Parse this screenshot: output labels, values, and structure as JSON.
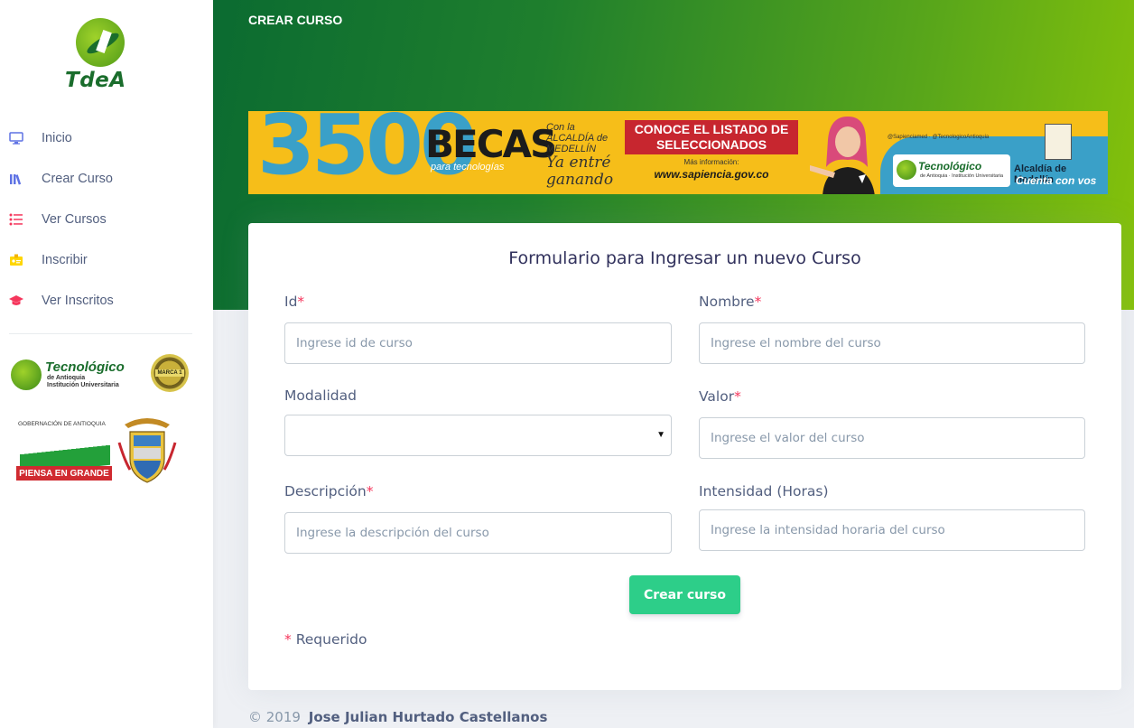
{
  "brand": {
    "logo_text": "TdeA"
  },
  "sidebar": {
    "items": [
      {
        "label": "Inicio",
        "icon": "monitor-icon",
        "color": "#5e72e4"
      },
      {
        "label": "Crear Curso",
        "icon": "books-icon",
        "color": "#5e72e4"
      },
      {
        "label": "Ver Cursos",
        "icon": "list-icon",
        "color": "#f5365c"
      },
      {
        "label": "Inscribir",
        "icon": "badge-icon",
        "color": "#ffd600"
      },
      {
        "label": "Ver Inscritos",
        "icon": "graduation-cap-icon",
        "color": "#f5365c"
      }
    ],
    "sponsor_tdea": {
      "name": "Tecnológico",
      "sub1": "de Antioquia",
      "sub2": "Institución Universitaria",
      "seal": "MARCA 1"
    },
    "sponsor_gov": {
      "title": "GOBERNACIÓN DE ANTIOQUIA",
      "slogan": "PIENSA EN GRANDE"
    }
  },
  "header": {
    "title": "CREAR CURSO"
  },
  "banner": {
    "number": "3500",
    "becas": "BECAS",
    "becas_sub": "para tecnologías",
    "script_small": "Con la ALCALDÍA de MEDELLÍN",
    "script_big": "Ya entré ganando",
    "conoce": "CONOCE EL LISTADO DE SELECCIONADOS",
    "info": "Más información:",
    "url": "www.sapiencia.gov.co",
    "social": "@Sapienciamed · @TecnologicoAntioquia",
    "tec_name": "Tecnológico",
    "tec_sub": "de Antioquia · Institución Universitaria",
    "alcaldia": "Alcaldía de Medellín",
    "cuenta": "Cuenta con vos"
  },
  "form": {
    "title": "Formulario para Ingresar un nuevo Curso",
    "id": {
      "label": "Id",
      "placeholder": "Ingrese id de curso"
    },
    "nombre": {
      "label": "Nombre",
      "placeholder": "Ingrese el nombre del curso"
    },
    "modalidad": {
      "label": "Modalidad",
      "value": ""
    },
    "valor": {
      "label": "Valor",
      "placeholder": "Ingrese el valor del curso"
    },
    "descripcion": {
      "label": "Descripción",
      "placeholder": "Ingrese la descripción del curso"
    },
    "intensidad": {
      "label": "Intensidad (Horas)",
      "placeholder": "Ingrese la intensidad horaria del curso"
    },
    "required_mark": "*",
    "submit_label": "Crear curso",
    "required_note": "Requerido"
  },
  "footer": {
    "copyright": "© 2019",
    "author": "Jose Julian Hurtado Castellanos"
  },
  "colors": {
    "accent": "#5e72e4",
    "success": "#2dce89",
    "danger": "#f5365c",
    "header_start": "#0b6b31",
    "header_end": "#86c20a"
  }
}
